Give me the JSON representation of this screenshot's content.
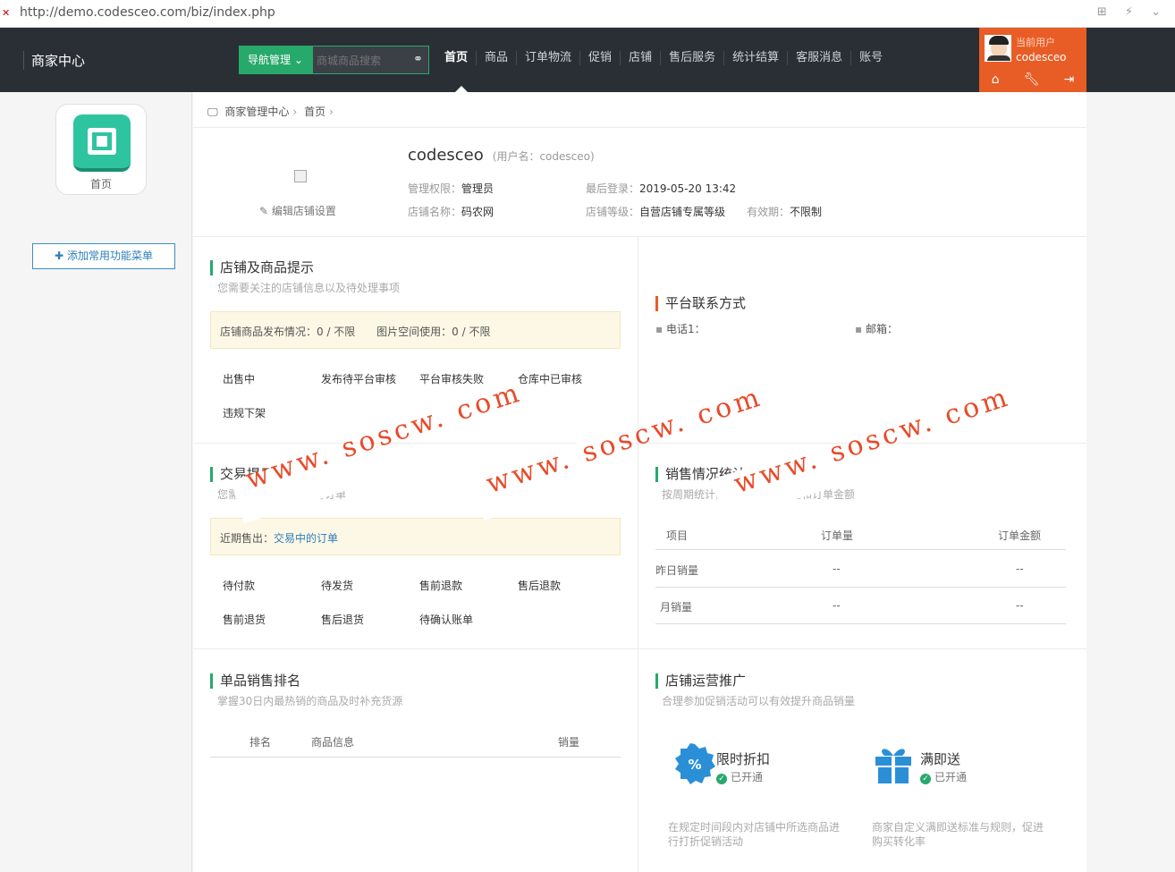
{
  "browser": {
    "url": "http://demo.codesceo.com/biz/index.php",
    "tool_icons": "⊞ ⚡ ⌄"
  },
  "header": {
    "brand": "商家中心",
    "nav_button": "导航管理",
    "search_placeholder": "商城商品搜索",
    "menu": [
      "首页",
      "商品",
      "订单物流",
      "促销",
      "店铺",
      "售后服务",
      "统计结算",
      "客服消息",
      "账号"
    ],
    "user_label": "当前用户",
    "username": "codesceo",
    "accent": "#e85d26",
    "nav_bg": "#2a2f35",
    "green": "#27a96b"
  },
  "sidebar": {
    "home_label": "首页",
    "add_menu": "添加常用功能菜单"
  },
  "breadcrumb": [
    "商家管理中心",
    "首页"
  ],
  "profile": {
    "name": "codesceo",
    "username_note": "(用户名：codesceo)",
    "edit_settings": "编辑店铺设置",
    "perm_label": "管理权限：",
    "perm_value": "管理员",
    "last_login_label": "最后登录：",
    "last_login_value": "2019-05-20 13:42",
    "shop_label": "店铺名称：",
    "shop_value": "码农网",
    "level_label": "店铺等级：",
    "level_value": "自营店铺专属等级",
    "valid_label": "有效期：",
    "valid_value": "不限制"
  },
  "shop_tips": {
    "title": "店铺及商品提示",
    "subtitle": "您需要关注的店铺信息以及待处理事项",
    "notice_goods": "店铺商品发布情况：0 /  不限",
    "notice_images": "图片空间使用：0 / 不限",
    "items": [
      "出售中",
      "发布待平台审核",
      "平台审核失败",
      "仓库中已审核",
      "违规下架"
    ]
  },
  "contact": {
    "title": "平台联系方式",
    "phone": "电话1：",
    "email": "邮箱："
  },
  "trade": {
    "title": "交易提示",
    "subtitle": "您需要立即处理的交易订单",
    "notice_prefix": "近期售出：",
    "notice_link": "交易中的订单",
    "items": [
      "待付款",
      "待发货",
      "售前退款",
      "售后退款",
      "售前退货",
      "售后退货",
      "待确认账单"
    ]
  },
  "sales": {
    "title": "销售情况统计",
    "subtitle": "按周期统计商家店铺的订单量和订单金额",
    "headers": [
      "项目",
      "订单量",
      "订单金额"
    ],
    "rows": [
      [
        "昨日销量",
        "--",
        "--"
      ],
      [
        "月销量",
        "--",
        "--"
      ]
    ]
  },
  "ranking": {
    "title": "单品销售排名",
    "subtitle": "掌握30日内最热销的商品及时补充货源",
    "headers": [
      "排名",
      "商品信息",
      "销量"
    ]
  },
  "promotion": {
    "title": "店铺运营推广",
    "subtitle": "合理参加促销活动可以有效提升商品销量",
    "cards": [
      {
        "name": "限时折扣",
        "status": "已开通",
        "desc": "在规定时间段内对店铺中所选商品进行打折促销活动",
        "icon": "percent-badge-icon"
      },
      {
        "name": "满即送",
        "status": "已开通",
        "desc": "商家自定义满即送标准与规则，促进购买转化率",
        "icon": "gift-icon"
      }
    ]
  },
  "watermark": "www. soscw. com"
}
